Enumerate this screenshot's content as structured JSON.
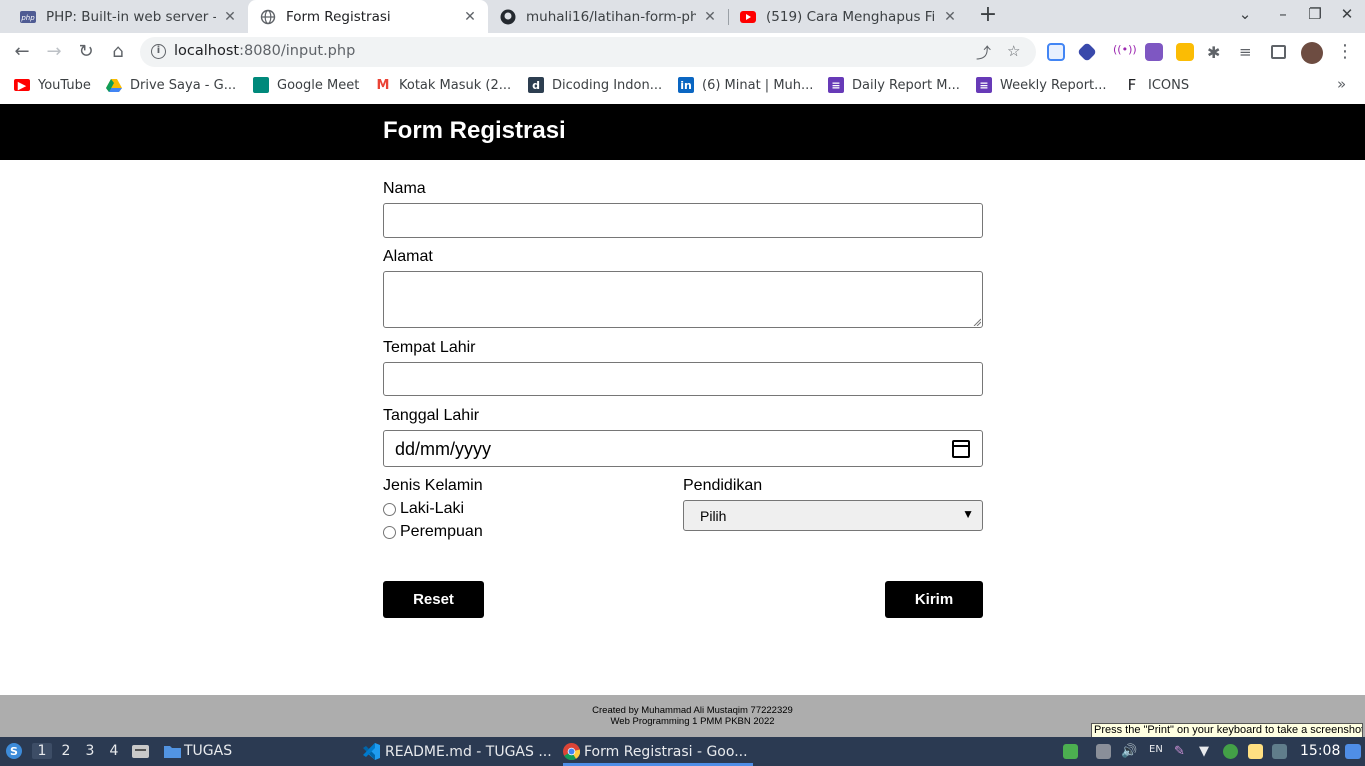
{
  "browser": {
    "tabs": [
      {
        "title": "PHP: Built-in web server - M",
        "icon": "php-icon",
        "active": false
      },
      {
        "title": "Form Registrasi",
        "icon": "globe-icon",
        "active": true
      },
      {
        "title": "muhali16/latihan-form-php",
        "icon": "github-icon",
        "active": false
      },
      {
        "title": "(519) Cara Menghapus File",
        "icon": "youtube-icon",
        "active": false
      }
    ],
    "url_host": "localhost",
    "url_path": ":8080/input.php",
    "bookmarks": [
      {
        "label": "YouTube",
        "icon": "youtube-icon",
        "color": "#ff0000"
      },
      {
        "label": "Drive Saya - G...",
        "icon": "drive-icon",
        "color": "#fbbc04"
      },
      {
        "label": "Google Meet",
        "icon": "meet-icon",
        "color": "#00897b"
      },
      {
        "label": "Kotak Masuk (2...",
        "icon": "gmail-icon",
        "color": "#ea4335"
      },
      {
        "label": "Dicoding Indon...",
        "icon": "dicoding-icon",
        "color": "#2d3e50"
      },
      {
        "label": "(6) Minat | Muh...",
        "icon": "linkedin-icon",
        "color": "#0a66c2"
      },
      {
        "label": "Daily Report M...",
        "icon": "form-icon",
        "color": "#673ab7"
      },
      {
        "label": "Weekly Report...",
        "icon": "form-icon",
        "color": "#673ab7"
      },
      {
        "label": "ICONS",
        "icon": "f-icon",
        "color": "#202124"
      }
    ]
  },
  "page": {
    "title": "Form Registrasi",
    "fields": {
      "nama_label": "Nama",
      "alamat_label": "Alamat",
      "tempat_label": "Tempat Lahir",
      "tanggal_label": "Tanggal Lahir",
      "tanggal_placeholder": "dd/mm/yyyy",
      "gender_label": "Jenis Kelamin",
      "gender_options": [
        "Laki-Laki",
        "Perempuan"
      ],
      "pendidikan_label": "Pendidikan",
      "pendidikan_selected": "Pilih"
    },
    "buttons": {
      "reset": "Reset",
      "submit": "Kirim"
    },
    "footer_line1": "Created by Muhammad Ali Mustaqim 77222329",
    "footer_line2": "Web Programming 1 PMM PKBN 2022"
  },
  "tooltip": "Press the \"Print\" on your keyboard to take a screenshot",
  "taskbar": {
    "workspaces": [
      "1",
      "2",
      "3",
      "4"
    ],
    "folder_label": "TUGAS",
    "apps": [
      {
        "label": "README.md - TUGAS ...",
        "icon": "vscode-icon"
      },
      {
        "label": "Form Registrasi - Goo...",
        "icon": "chrome-icon"
      }
    ],
    "lang": "EN",
    "time": "15:08"
  }
}
